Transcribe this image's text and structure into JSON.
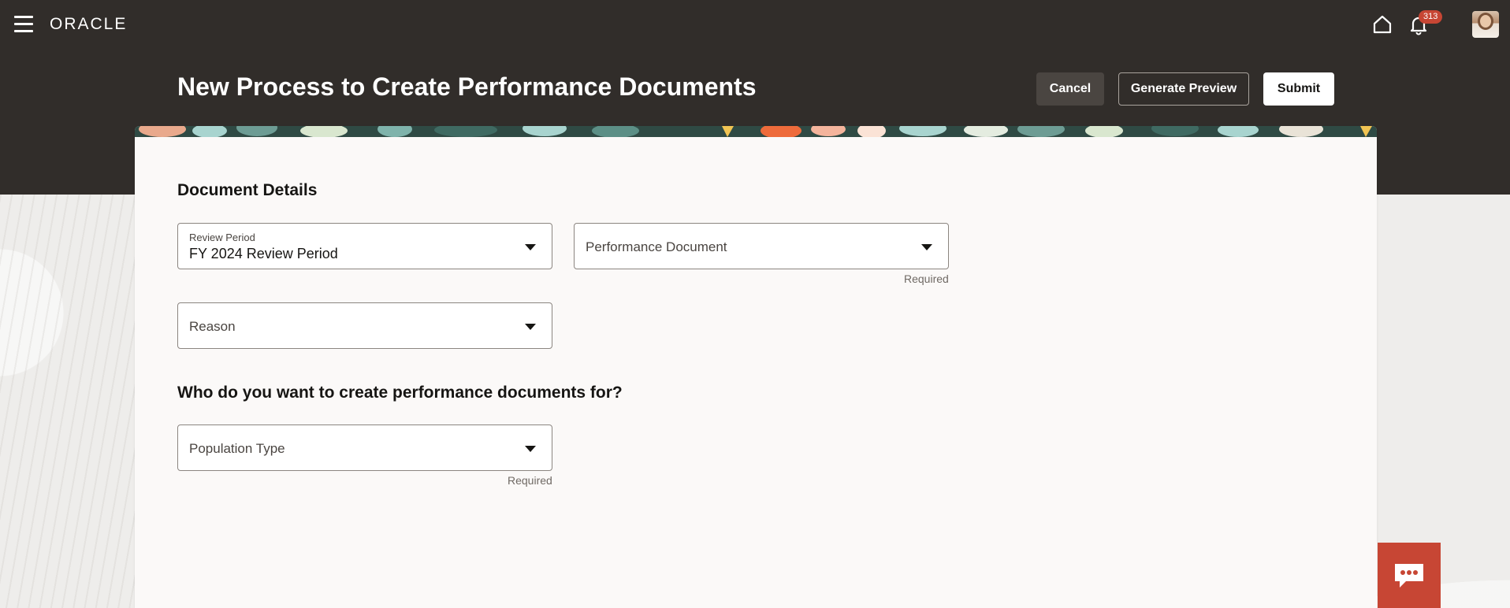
{
  "app": {
    "logo": "ORACLE"
  },
  "header": {
    "notification_count": "313",
    "page_title": "New Process to Create Performance Documents",
    "cancel_label": "Cancel",
    "preview_label": "Generate Preview",
    "submit_label": "Submit"
  },
  "document_details": {
    "title": "Document Details",
    "review_period": {
      "label": "Review Period",
      "value": "FY 2024 Review Period"
    },
    "performance_document": {
      "placeholder": "Performance Document",
      "required_text": "Required"
    },
    "reason": {
      "placeholder": "Reason"
    }
  },
  "population": {
    "title": "Who do you want to create performance documents for?",
    "population_type": {
      "placeholder": "Population Type",
      "required_text": "Required"
    }
  },
  "icons": {
    "menu": "hamburger-menu-icon",
    "home": "home-icon",
    "notifications": "bell-icon",
    "chat": "chat-bubble-icon"
  },
  "colors": {
    "header_bg": "#312d2a",
    "badge": "#c74634",
    "chat_button": "#c74634",
    "card_bg": "#fbf9f8"
  }
}
